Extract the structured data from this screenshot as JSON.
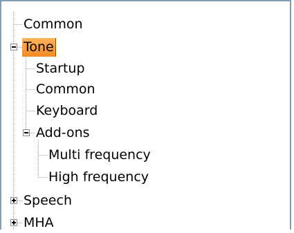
{
  "tree": {
    "nodes": [
      {
        "label": "Common",
        "expander": "none",
        "selected": false
      },
      {
        "label": "Tone",
        "expander": "expanded",
        "selected": true
      },
      {
        "label": "Startup",
        "expander": "none",
        "selected": false
      },
      {
        "label": "Common",
        "expander": "none",
        "selected": false
      },
      {
        "label": "Keyboard",
        "expander": "none",
        "selected": false
      },
      {
        "label": "Add-ons",
        "expander": "expanded",
        "selected": false
      },
      {
        "label": "Multi frequency",
        "expander": "none",
        "selected": false
      },
      {
        "label": "High frequency",
        "expander": "none",
        "selected": false
      },
      {
        "label": "Speech",
        "expander": "collapsed",
        "selected": false
      },
      {
        "label": "MHA",
        "expander": "collapsed",
        "selected": false
      }
    ]
  },
  "colors": {
    "border": "#7f9db9",
    "guide": "#a0a0a0",
    "selection": "#f5a04a",
    "selection_edge": "#9c4a00"
  }
}
